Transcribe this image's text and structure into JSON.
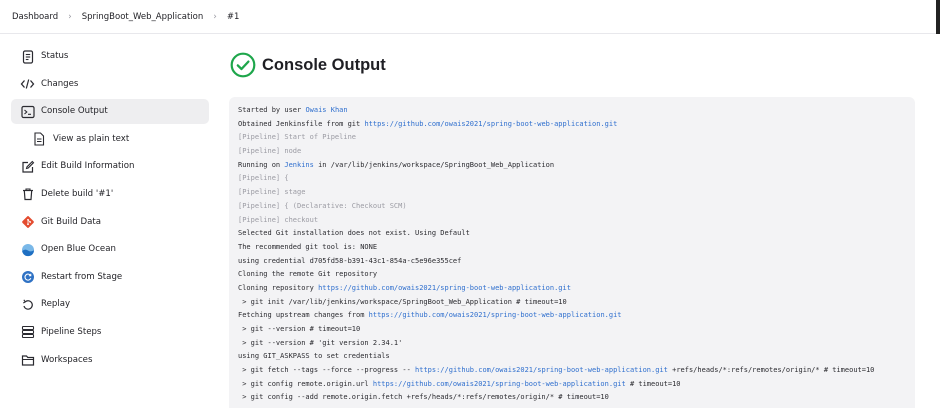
{
  "breadcrumb": {
    "dashboard": "Dashboard",
    "job": "SpringBoot_Web_Application",
    "build": "#1",
    "separator": "›"
  },
  "sidebar": {
    "items": [
      {
        "label": "Status",
        "icon": "status-icon"
      },
      {
        "label": "Changes",
        "icon": "code-icon"
      },
      {
        "label": "Console Output",
        "icon": "terminal-icon",
        "active": true
      },
      {
        "label": "View as plain text",
        "icon": "document-icon",
        "sub": true
      },
      {
        "label": "Edit Build Information",
        "icon": "edit-icon"
      },
      {
        "label": "Delete build '#1'",
        "icon": "trash-icon"
      },
      {
        "label": "Git Build Data",
        "icon": "git-icon"
      },
      {
        "label": "Open Blue Ocean",
        "icon": "blue-ocean-icon"
      },
      {
        "label": "Restart from Stage",
        "icon": "restart-icon"
      },
      {
        "label": "Replay",
        "icon": "replay-icon"
      },
      {
        "label": "Pipeline Steps",
        "icon": "pipeline-steps-icon"
      },
      {
        "label": "Workspaces",
        "icon": "folder-icon"
      }
    ]
  },
  "main": {
    "title": "Console Output",
    "status_icon": "success-check-icon",
    "status_color": "#1ea64b"
  },
  "console": {
    "link_color": "#2f6fce",
    "lines": [
      {
        "parts": [
          {
            "t": "Started by user "
          },
          {
            "t": "Owais Khan",
            "link": true
          }
        ]
      },
      {
        "parts": [
          {
            "t": "Obtained Jenkinsfile from git "
          },
          {
            "t": "https://github.com/owais2021/spring-boot-web-application.git",
            "link": true
          }
        ]
      },
      {
        "dim": true,
        "parts": [
          {
            "t": "[Pipeline] Start of Pipeline"
          }
        ]
      },
      {
        "dim": true,
        "parts": [
          {
            "t": "[Pipeline] node"
          }
        ]
      },
      {
        "parts": [
          {
            "t": "Running on "
          },
          {
            "t": "Jenkins",
            "link": true
          },
          {
            "t": " in /var/lib/jenkins/workspace/SpringBoot_Web_Application"
          }
        ]
      },
      {
        "dim": true,
        "parts": [
          {
            "t": "[Pipeline] {"
          }
        ]
      },
      {
        "dim": true,
        "parts": [
          {
            "t": "[Pipeline] stage"
          }
        ]
      },
      {
        "dim": true,
        "parts": [
          {
            "t": "[Pipeline] { (Declarative: Checkout SCM)"
          }
        ]
      },
      {
        "dim": true,
        "parts": [
          {
            "t": "[Pipeline] checkout"
          }
        ]
      },
      {
        "parts": [
          {
            "t": "Selected Git installation does not exist. Using Default"
          }
        ]
      },
      {
        "parts": [
          {
            "t": "The recommended git tool is: NONE"
          }
        ]
      },
      {
        "parts": [
          {
            "t": "using credential d705fd58-b391-43c1-854a-c5e96e355cef"
          }
        ]
      },
      {
        "parts": [
          {
            "t": "Cloning the remote Git repository"
          }
        ]
      },
      {
        "parts": [
          {
            "t": "Cloning repository "
          },
          {
            "t": "https://github.com/owais2021/spring-boot-web-application.git",
            "link": true
          }
        ]
      },
      {
        "parts": [
          {
            "t": " > git init /var/lib/jenkins/workspace/SpringBoot_Web_Application # timeout=10"
          }
        ]
      },
      {
        "parts": [
          {
            "t": "Fetching upstream changes from "
          },
          {
            "t": "https://github.com/owais2021/spring-boot-web-application.git",
            "link": true
          }
        ]
      },
      {
        "parts": [
          {
            "t": " > git --version # timeout=10"
          }
        ]
      },
      {
        "parts": [
          {
            "t": " > git --version # 'git version 2.34.1'"
          }
        ]
      },
      {
        "parts": [
          {
            "t": "using GIT_ASKPASS to set credentials"
          }
        ]
      },
      {
        "parts": [
          {
            "t": " > git fetch --tags --force --progress -- "
          },
          {
            "t": "https://github.com/owais2021/spring-boot-web-application.git",
            "link": true
          },
          {
            "t": " +refs/heads/*:refs/remotes/origin/* # timeout=10"
          }
        ]
      },
      {
        "parts": [
          {
            "t": " > git config remote.origin.url "
          },
          {
            "t": "https://github.com/owais2021/spring-boot-web-application.git",
            "link": true
          },
          {
            "t": " # timeout=10"
          }
        ]
      },
      {
        "parts": [
          {
            "t": " > git config --add remote.origin.fetch +refs/heads/*:refs/remotes/origin/* # timeout=10"
          }
        ]
      }
    ]
  }
}
